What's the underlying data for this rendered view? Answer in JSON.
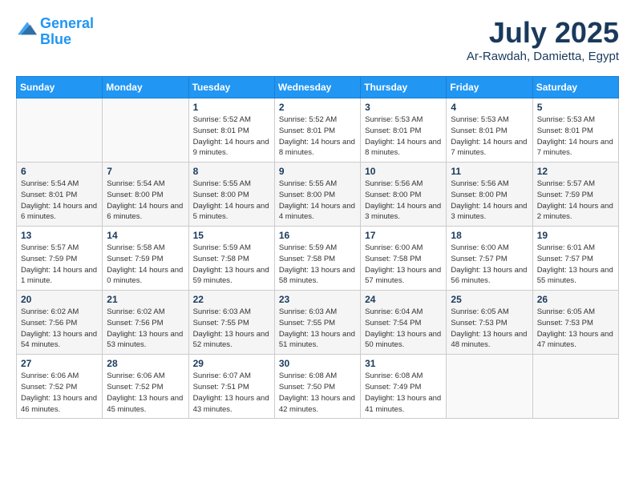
{
  "header": {
    "logo_line1": "General",
    "logo_line2": "Blue",
    "month": "July 2025",
    "location": "Ar-Rawdah, Damietta, Egypt"
  },
  "weekdays": [
    "Sunday",
    "Monday",
    "Tuesday",
    "Wednesday",
    "Thursday",
    "Friday",
    "Saturday"
  ],
  "weeks": [
    [
      {
        "day": "",
        "info": ""
      },
      {
        "day": "",
        "info": ""
      },
      {
        "day": "1",
        "info": "Sunrise: 5:52 AM\nSunset: 8:01 PM\nDaylight: 14 hours and 9 minutes."
      },
      {
        "day": "2",
        "info": "Sunrise: 5:52 AM\nSunset: 8:01 PM\nDaylight: 14 hours and 8 minutes."
      },
      {
        "day": "3",
        "info": "Sunrise: 5:53 AM\nSunset: 8:01 PM\nDaylight: 14 hours and 8 minutes."
      },
      {
        "day": "4",
        "info": "Sunrise: 5:53 AM\nSunset: 8:01 PM\nDaylight: 14 hours and 7 minutes."
      },
      {
        "day": "5",
        "info": "Sunrise: 5:53 AM\nSunset: 8:01 PM\nDaylight: 14 hours and 7 minutes."
      }
    ],
    [
      {
        "day": "6",
        "info": "Sunrise: 5:54 AM\nSunset: 8:01 PM\nDaylight: 14 hours and 6 minutes."
      },
      {
        "day": "7",
        "info": "Sunrise: 5:54 AM\nSunset: 8:00 PM\nDaylight: 14 hours and 6 minutes."
      },
      {
        "day": "8",
        "info": "Sunrise: 5:55 AM\nSunset: 8:00 PM\nDaylight: 14 hours and 5 minutes."
      },
      {
        "day": "9",
        "info": "Sunrise: 5:55 AM\nSunset: 8:00 PM\nDaylight: 14 hours and 4 minutes."
      },
      {
        "day": "10",
        "info": "Sunrise: 5:56 AM\nSunset: 8:00 PM\nDaylight: 14 hours and 3 minutes."
      },
      {
        "day": "11",
        "info": "Sunrise: 5:56 AM\nSunset: 8:00 PM\nDaylight: 14 hours and 3 minutes."
      },
      {
        "day": "12",
        "info": "Sunrise: 5:57 AM\nSunset: 7:59 PM\nDaylight: 14 hours and 2 minutes."
      }
    ],
    [
      {
        "day": "13",
        "info": "Sunrise: 5:57 AM\nSunset: 7:59 PM\nDaylight: 14 hours and 1 minute."
      },
      {
        "day": "14",
        "info": "Sunrise: 5:58 AM\nSunset: 7:59 PM\nDaylight: 14 hours and 0 minutes."
      },
      {
        "day": "15",
        "info": "Sunrise: 5:59 AM\nSunset: 7:58 PM\nDaylight: 13 hours and 59 minutes."
      },
      {
        "day": "16",
        "info": "Sunrise: 5:59 AM\nSunset: 7:58 PM\nDaylight: 13 hours and 58 minutes."
      },
      {
        "day": "17",
        "info": "Sunrise: 6:00 AM\nSunset: 7:58 PM\nDaylight: 13 hours and 57 minutes."
      },
      {
        "day": "18",
        "info": "Sunrise: 6:00 AM\nSunset: 7:57 PM\nDaylight: 13 hours and 56 minutes."
      },
      {
        "day": "19",
        "info": "Sunrise: 6:01 AM\nSunset: 7:57 PM\nDaylight: 13 hours and 55 minutes."
      }
    ],
    [
      {
        "day": "20",
        "info": "Sunrise: 6:02 AM\nSunset: 7:56 PM\nDaylight: 13 hours and 54 minutes."
      },
      {
        "day": "21",
        "info": "Sunrise: 6:02 AM\nSunset: 7:56 PM\nDaylight: 13 hours and 53 minutes."
      },
      {
        "day": "22",
        "info": "Sunrise: 6:03 AM\nSunset: 7:55 PM\nDaylight: 13 hours and 52 minutes."
      },
      {
        "day": "23",
        "info": "Sunrise: 6:03 AM\nSunset: 7:55 PM\nDaylight: 13 hours and 51 minutes."
      },
      {
        "day": "24",
        "info": "Sunrise: 6:04 AM\nSunset: 7:54 PM\nDaylight: 13 hours and 50 minutes."
      },
      {
        "day": "25",
        "info": "Sunrise: 6:05 AM\nSunset: 7:53 PM\nDaylight: 13 hours and 48 minutes."
      },
      {
        "day": "26",
        "info": "Sunrise: 6:05 AM\nSunset: 7:53 PM\nDaylight: 13 hours and 47 minutes."
      }
    ],
    [
      {
        "day": "27",
        "info": "Sunrise: 6:06 AM\nSunset: 7:52 PM\nDaylight: 13 hours and 46 minutes."
      },
      {
        "day": "28",
        "info": "Sunrise: 6:06 AM\nSunset: 7:52 PM\nDaylight: 13 hours and 45 minutes."
      },
      {
        "day": "29",
        "info": "Sunrise: 6:07 AM\nSunset: 7:51 PM\nDaylight: 13 hours and 43 minutes."
      },
      {
        "day": "30",
        "info": "Sunrise: 6:08 AM\nSunset: 7:50 PM\nDaylight: 13 hours and 42 minutes."
      },
      {
        "day": "31",
        "info": "Sunrise: 6:08 AM\nSunset: 7:49 PM\nDaylight: 13 hours and 41 minutes."
      },
      {
        "day": "",
        "info": ""
      },
      {
        "day": "",
        "info": ""
      }
    ]
  ]
}
